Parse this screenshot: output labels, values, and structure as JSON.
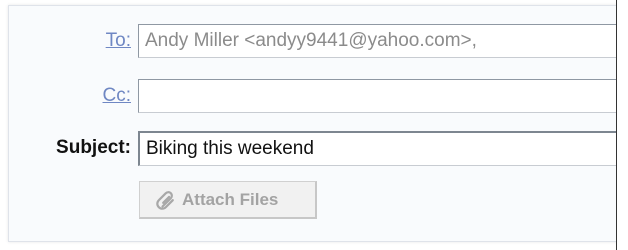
{
  "compose": {
    "to_label": "To:",
    "to_value": "Andy Miller <andyy9441@yahoo.com>,",
    "cc_label": "Cc:",
    "cc_value": "",
    "subject_label": "Subject:",
    "subject_value": "Biking this weekend",
    "attach_label": "Attach Files",
    "attach_icon": "paperclip-icon"
  },
  "colors": {
    "link_label": "#6f87c3",
    "field_border": "#8f98a3",
    "panel_background": "#f9fbfd",
    "disabled_button_text": "#a3a3a3"
  }
}
